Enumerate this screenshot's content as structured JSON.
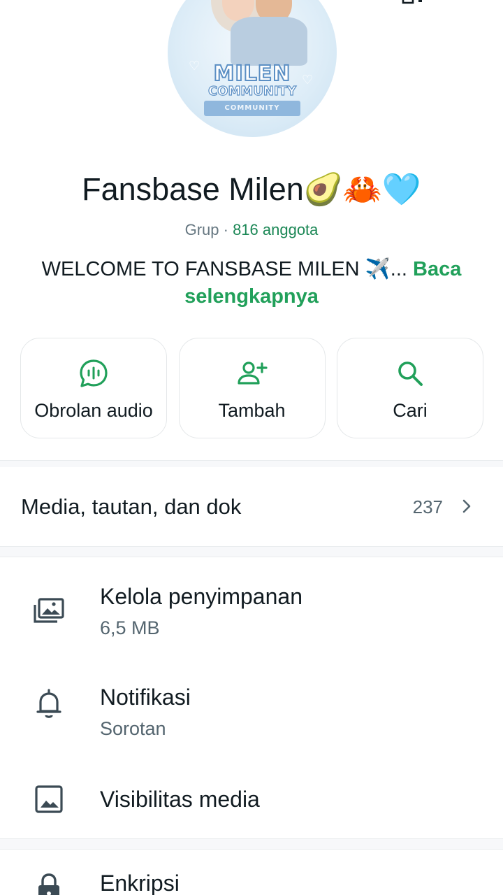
{
  "group": {
    "name": "Fansbase Milen🥑🦀🩵",
    "type_label": "Grup",
    "separator": " · ",
    "members_label": "816 anggota",
    "description": "WELCOME TO FANSBASE MILEN ✈️... ",
    "read_more": "Baca selengkapnya"
  },
  "avatar_logo": {
    "line1": "MILEN",
    "line2": "COMMUNITY",
    "ribbon": "COMMUNITY"
  },
  "actions": [
    {
      "label": "Obrolan audio",
      "icon": "audio-chat-icon"
    },
    {
      "label": "Tambah",
      "icon": "add-member-icon"
    },
    {
      "label": "Cari",
      "icon": "search-icon"
    }
  ],
  "media": {
    "label": "Media, tautan, dan dok",
    "count": "237"
  },
  "settings": [
    {
      "title": "Kelola penyimpanan",
      "subtitle": "6,5 MB",
      "icon": "storage-icon"
    },
    {
      "title": "Notifikasi",
      "subtitle": "Sorotan",
      "icon": "bell-icon"
    },
    {
      "title": "Visibilitas media",
      "icon": "image-icon"
    },
    {
      "title": "Enkripsi",
      "icon": "lock-icon"
    }
  ],
  "colors": {
    "accent_green": "#21a05a",
    "member_green": "#1b8755",
    "text_primary": "#111b21",
    "text_secondary": "#667781"
  }
}
